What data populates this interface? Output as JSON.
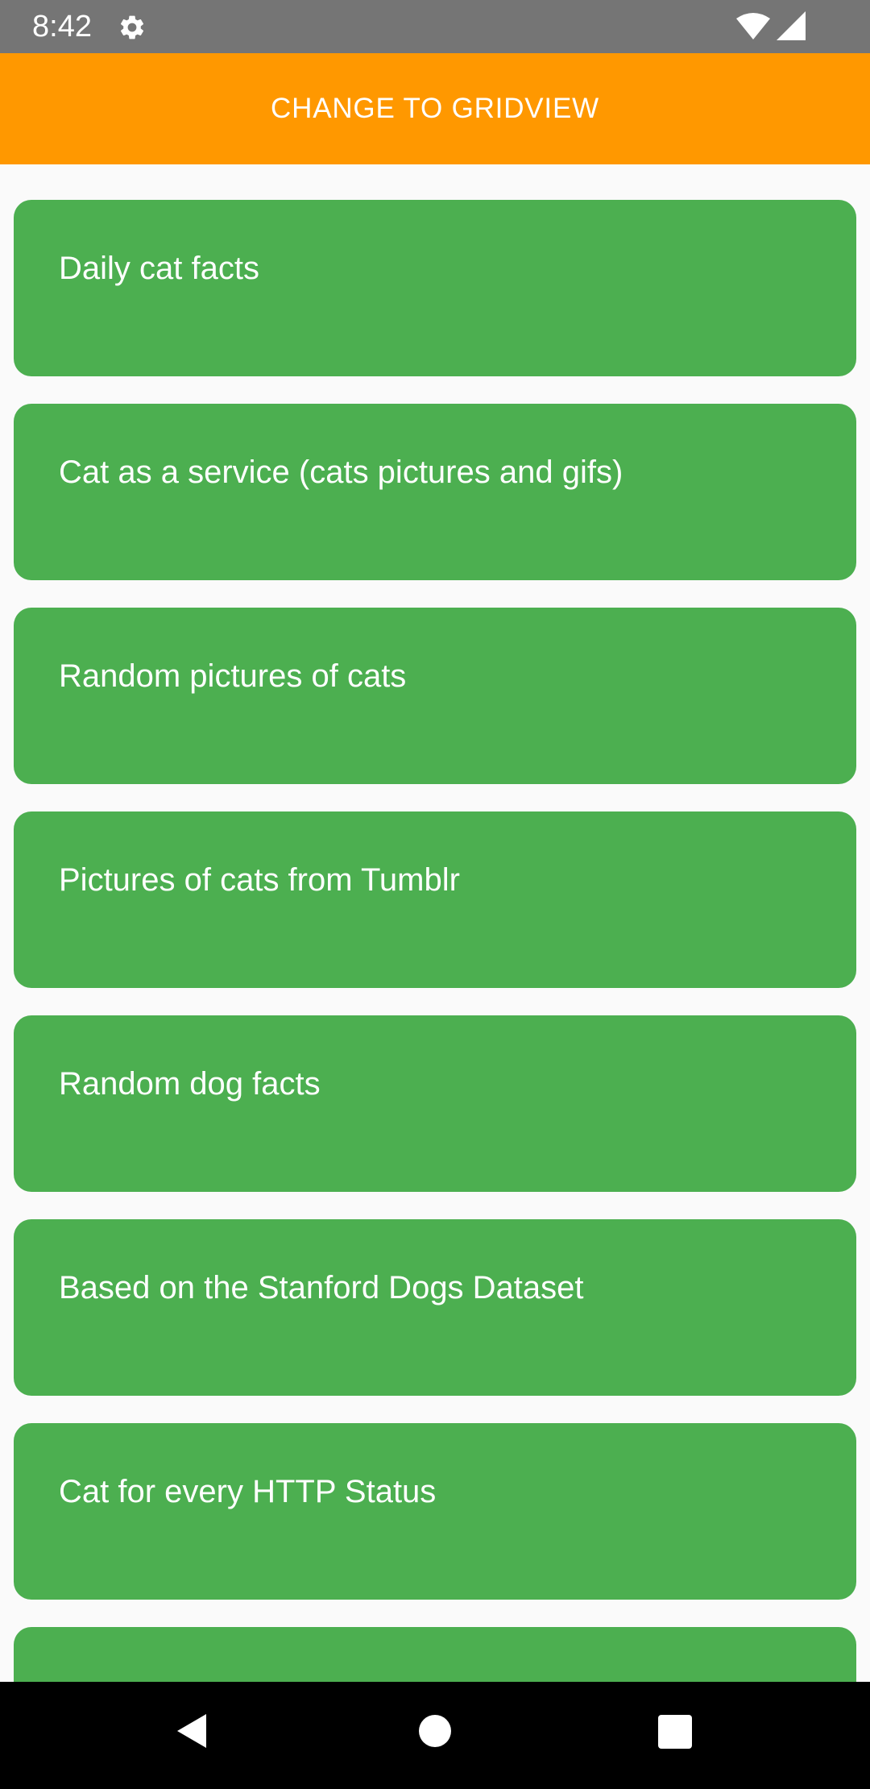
{
  "status_bar": {
    "time": "8:42",
    "icons": [
      "gear-icon",
      "wifi-icon",
      "cell-signal-icon"
    ]
  },
  "top_button": {
    "label": "CHANGE TO GRIDVIEW",
    "color": "#ff9800"
  },
  "list": {
    "card_color": "#4caf50",
    "items": [
      {
        "label": "Daily cat facts"
      },
      {
        "label": "Cat as a service (cats pictures and gifs)"
      },
      {
        "label": "Random pictures of cats"
      },
      {
        "label": "Pictures of cats from Tumblr"
      },
      {
        "label": "Random dog facts"
      },
      {
        "label": "Based on the Stanford Dogs Dataset"
      },
      {
        "label": "Cat for every HTTP Status"
      },
      {
        "label": ""
      }
    ]
  },
  "nav_bar": {
    "icons": [
      "back-icon",
      "home-icon",
      "recents-icon"
    ]
  }
}
